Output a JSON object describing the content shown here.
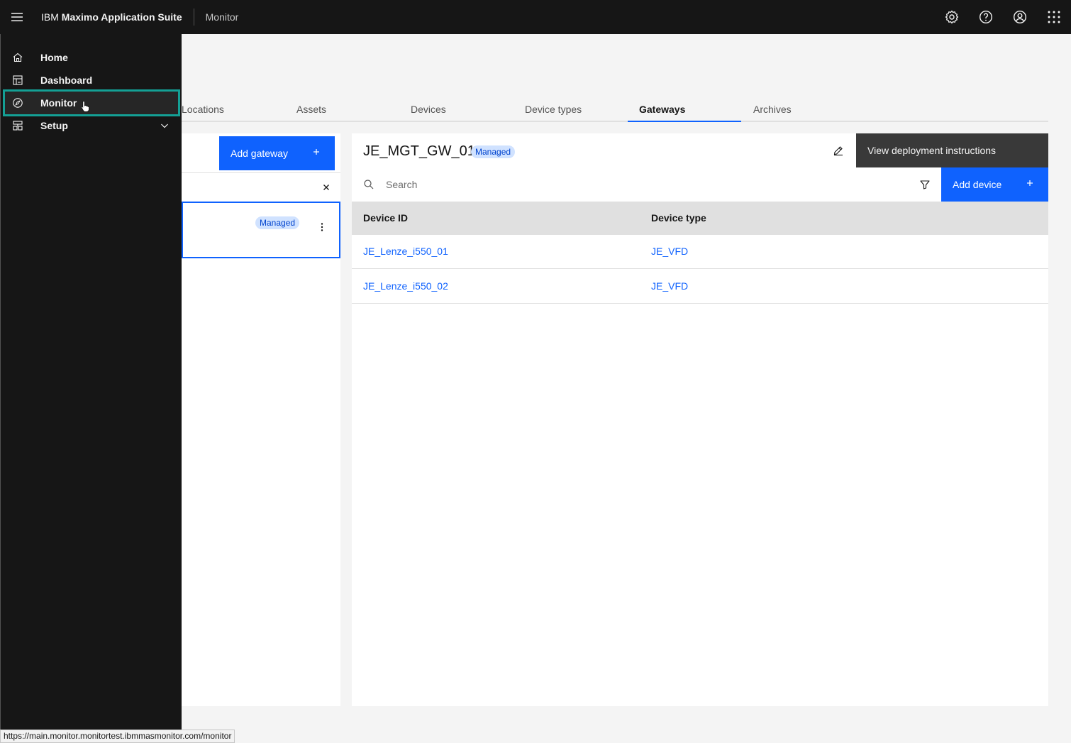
{
  "header": {
    "brand_prefix": "IBM",
    "brand_name": "Maximo Application Suite",
    "app_name": "Monitor",
    "icons": [
      "menu-icon",
      "settings-icon",
      "help-icon",
      "user-icon",
      "app-switcher-icon"
    ]
  },
  "sidenav": {
    "items": [
      {
        "label": "Home",
        "icon": "home-icon"
      },
      {
        "label": "Dashboard",
        "icon": "dashboard-icon"
      },
      {
        "label": "Monitor",
        "icon": "compass-icon",
        "active": true
      },
      {
        "label": "Setup",
        "icon": "setup-icon",
        "expandable": true
      }
    ]
  },
  "tabs": [
    {
      "label": "Locations"
    },
    {
      "label": "Assets"
    },
    {
      "label": "Devices"
    },
    {
      "label": "Device types"
    },
    {
      "label": "Gateways",
      "active": true
    },
    {
      "label": "Archives"
    }
  ],
  "left_panel": {
    "add_gateway_label": "Add gateway",
    "gateway_card": {
      "tag": "Managed"
    }
  },
  "right_panel": {
    "title": "JE_MGT_GW_01",
    "tag": "Managed",
    "tooltip": "View deployment instructions",
    "search_placeholder": "Search",
    "add_device_label": "Add device",
    "table": {
      "headers": [
        "Device ID",
        "Device type"
      ],
      "rows": [
        [
          "JE_Lenze_i550_01",
          "JE_VFD"
        ],
        [
          "JE_Lenze_i550_02",
          "JE_VFD"
        ]
      ]
    }
  },
  "statusbar": {
    "url": "https://main.monitor.monitortest.ibmmasmonitor.com/monitor"
  },
  "colors": {
    "accent": "#0f62fe",
    "nav_bg": "#161616",
    "highlight": "#14a095",
    "tag_bg": "#d0e2ff"
  }
}
